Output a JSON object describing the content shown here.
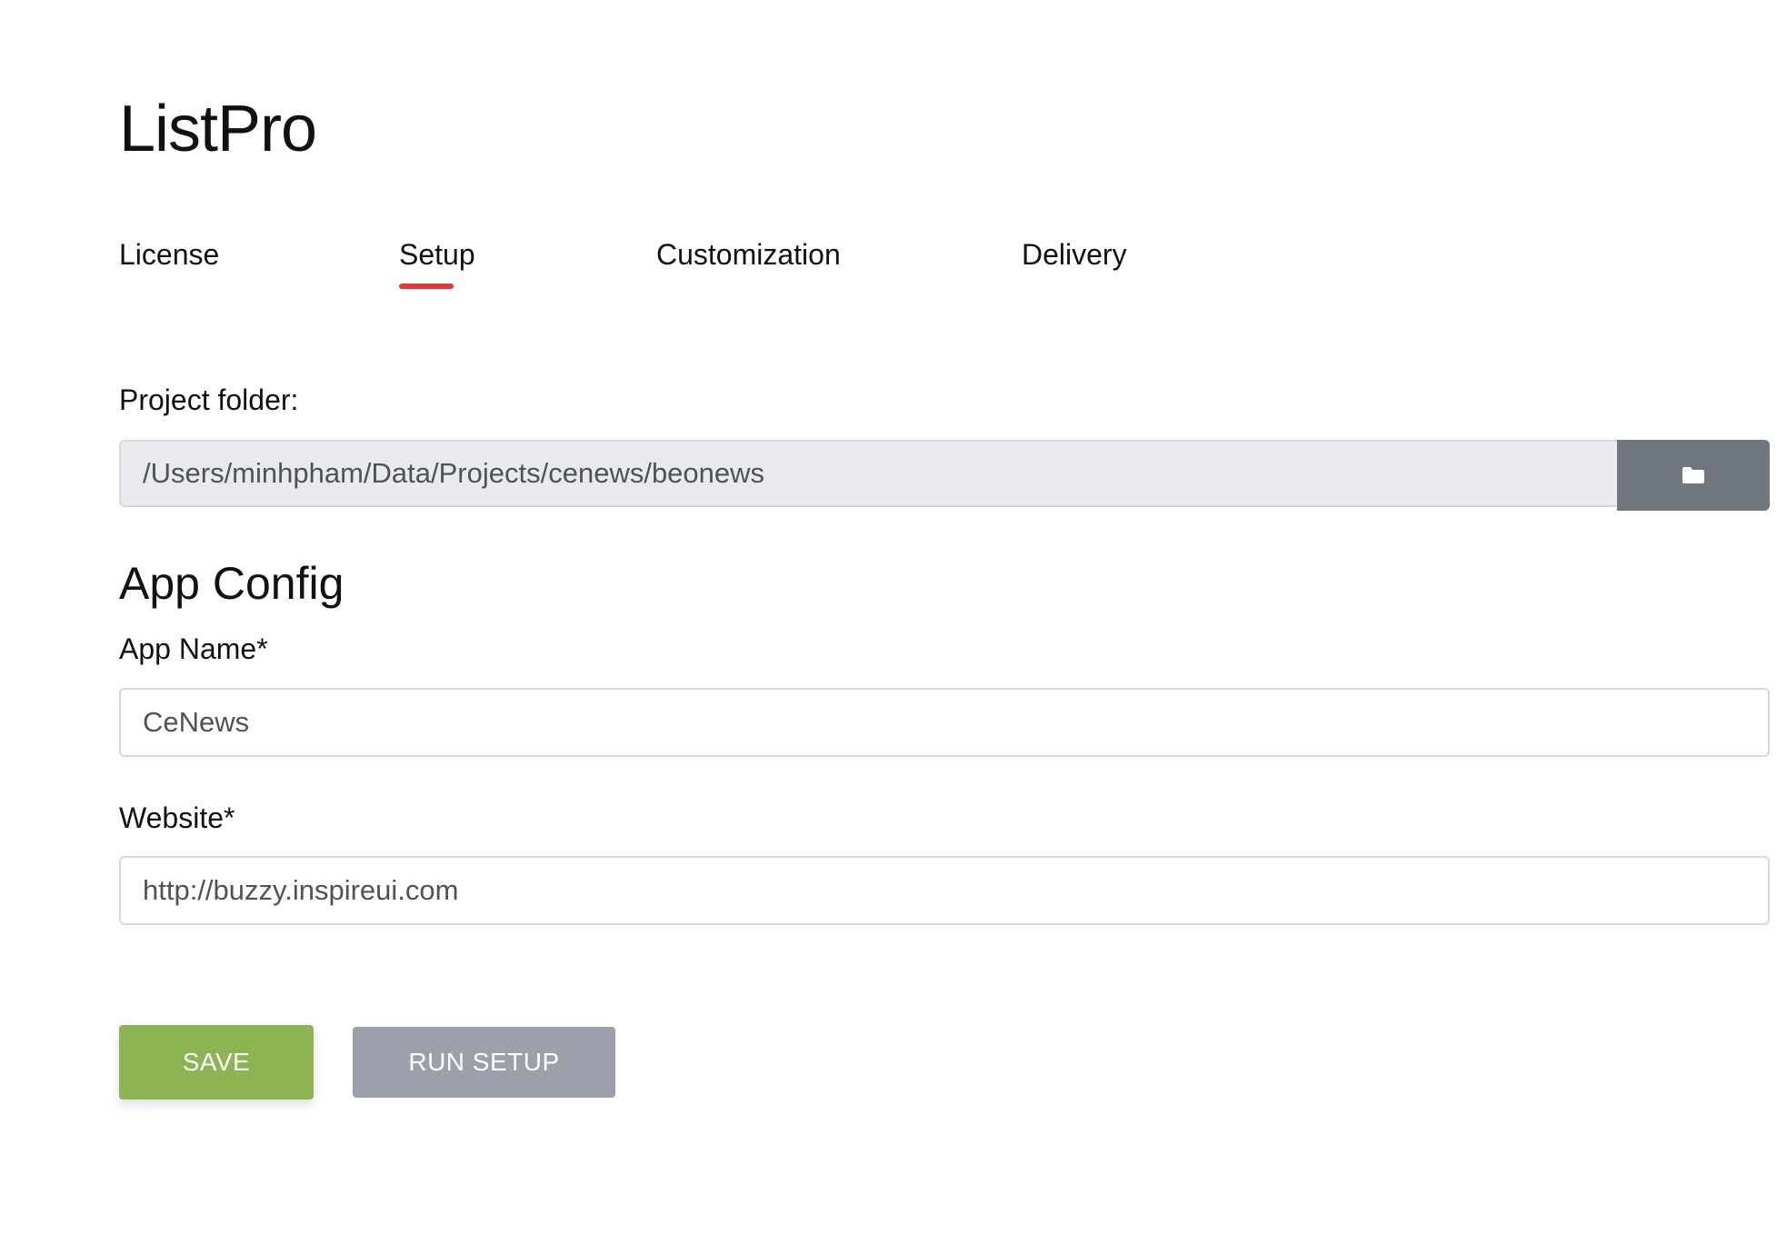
{
  "app": {
    "title": "ListPro"
  },
  "tabs": [
    {
      "label": "License",
      "active": false
    },
    {
      "label": "Setup",
      "active": true
    },
    {
      "label": "Customization",
      "active": false
    },
    {
      "label": "Delivery",
      "active": false
    }
  ],
  "project_folder": {
    "label": "Project folder:",
    "value": "/Users/minhpham/Data/Projects/cenews/beonews",
    "browse_icon": "folder-icon"
  },
  "app_config": {
    "section_title": "App Config",
    "app_name": {
      "label": "App Name*",
      "value": "CeNews"
    },
    "website": {
      "label": "Website*",
      "value": "http://buzzy.inspireui.com"
    }
  },
  "actions": {
    "save_label": "SAVE",
    "run_setup_label": "RUN SETUP"
  },
  "colors": {
    "tab_active_underline": "#e53935",
    "save_button": "#8bb553",
    "run_setup_button": "#9ba0aa",
    "browse_button": "#6f767e",
    "readonly_input_bg": "#e9eaee"
  }
}
